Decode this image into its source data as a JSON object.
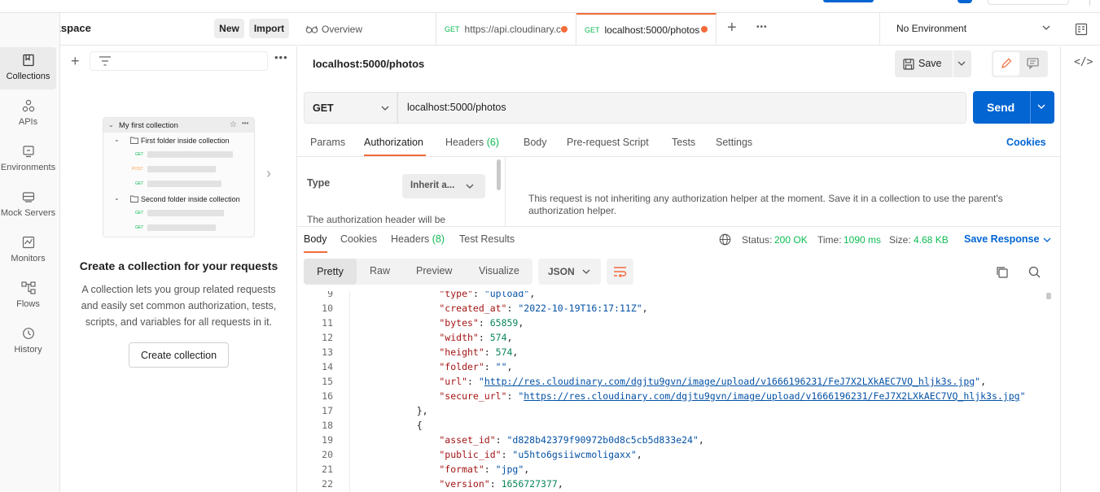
{
  "workspace": {
    "title": "My Workspace",
    "new_label": "New",
    "import_label": "Import"
  },
  "rail": [
    {
      "label": "Collections",
      "icon": "collections-icon"
    },
    {
      "label": "APIs",
      "icon": "apis-icon"
    },
    {
      "label": "Environments",
      "icon": "environments-icon"
    },
    {
      "label": "Mock Servers",
      "icon": "mock-servers-icon"
    },
    {
      "label": "Monitors",
      "icon": "monitors-icon"
    },
    {
      "label": "Flows",
      "icon": "flows-icon"
    },
    {
      "label": "History",
      "icon": "history-icon"
    }
  ],
  "illustration": {
    "collection": "My first collection",
    "folder1": "First folder inside collection",
    "folder2": "Second folder inside collection",
    "m1": "GET",
    "m2": "POST",
    "m3": "GET",
    "m4": "GET",
    "m5": "GET"
  },
  "empty": {
    "title": "Create a collection for your requests",
    "desc": "A collection lets you group related requests and easily set common authorization, tests, scripts, and variables for all requests in it.",
    "button": "Create collection"
  },
  "tabs": [
    {
      "label": "Overview"
    },
    {
      "method": "GET",
      "label": "https://api.cloudinary.c"
    },
    {
      "method": "GET",
      "label": "localhost:5000/photos"
    }
  ],
  "environment": "No Environment",
  "request": {
    "name": "localhost:5000/photos",
    "save_label": "Save",
    "method": "GET",
    "url": "localhost:5000/photos",
    "send_label": "Send"
  },
  "req_tabs": {
    "params": "Params",
    "authorization": "Authorization",
    "headers": "Headers",
    "headers_count": "(6)",
    "body": "Body",
    "prerequest": "Pre-request Script",
    "tests": "Tests",
    "settings": "Settings",
    "cookies": "Cookies"
  },
  "auth": {
    "type_label": "Type",
    "type_value": "Inherit a...",
    "note": "The authorization header will be",
    "message": "This request is not inheriting any authorization helper at the moment. Save it in a collection to use the parent's authorization helper."
  },
  "response": {
    "tabs": {
      "body": "Body",
      "cookies": "Cookies",
      "headers": "Headers",
      "headers_count": "(8)",
      "tests": "Test Results"
    },
    "status_label": "Status:",
    "status": "200 OK",
    "time_label": "Time:",
    "time": "1090 ms",
    "size_label": "Size:",
    "size": "4.68 KB",
    "save_response": "Save Response",
    "views": {
      "pretty": "Pretty",
      "raw": "Raw",
      "preview": "Preview",
      "visualize": "Visualize"
    },
    "format": "JSON"
  },
  "code": [
    {
      "n": "9",
      "parts": [
        [
          "k",
          "        \"type\""
        ],
        [
          "p",
          ": "
        ],
        [
          "s",
          "\"upload\""
        ],
        [
          "p",
          ","
        ]
      ]
    },
    {
      "n": "10",
      "parts": [
        [
          "k",
          "        \"created_at\""
        ],
        [
          "p",
          ": "
        ],
        [
          "s",
          "\"2022-10-19T16:17:11Z\""
        ],
        [
          "p",
          ","
        ]
      ]
    },
    {
      "n": "11",
      "parts": [
        [
          "k",
          "        \"bytes\""
        ],
        [
          "p",
          ": "
        ],
        [
          "n",
          "65859"
        ],
        [
          "p",
          ","
        ]
      ]
    },
    {
      "n": "12",
      "parts": [
        [
          "k",
          "        \"width\""
        ],
        [
          "p",
          ": "
        ],
        [
          "n",
          "574"
        ],
        [
          "p",
          ","
        ]
      ]
    },
    {
      "n": "13",
      "parts": [
        [
          "k",
          "        \"height\""
        ],
        [
          "p",
          ": "
        ],
        [
          "n",
          "574"
        ],
        [
          "p",
          ","
        ]
      ]
    },
    {
      "n": "14",
      "parts": [
        [
          "k",
          "        \"folder\""
        ],
        [
          "p",
          ": "
        ],
        [
          "s",
          "\"\""
        ],
        [
          "p",
          ","
        ]
      ]
    },
    {
      "n": "15",
      "parts": [
        [
          "k",
          "        \"url\""
        ],
        [
          "p",
          ": "
        ],
        [
          "s",
          "\""
        ],
        [
          "u",
          "http://res.cloudinary.com/dgjtu9gvn/image/upload/v1666196231/FeJ7X2LXkAEC7VQ_hljk3s.jpg"
        ],
        [
          "s",
          "\""
        ],
        [
          "p",
          ","
        ]
      ]
    },
    {
      "n": "16",
      "parts": [
        [
          "k",
          "        \"secure_url\""
        ],
        [
          "p",
          ": "
        ],
        [
          "s",
          "\""
        ],
        [
          "u",
          "https://res.cloudinary.com/dgjtu9gvn/image/upload/v1666196231/FeJ7X2LXkAEC7VQ_hljk3s.jpg"
        ],
        [
          "s",
          "\""
        ]
      ]
    },
    {
      "n": "17",
      "parts": [
        [
          "p",
          "    },"
        ]
      ]
    },
    {
      "n": "18",
      "parts": [
        [
          "p",
          "    {"
        ]
      ]
    },
    {
      "n": "19",
      "parts": [
        [
          "k",
          "        \"asset_id\""
        ],
        [
          "p",
          ": "
        ],
        [
          "s",
          "\"d828b42379f90972b0d8c5cb5d833e24\""
        ],
        [
          "p",
          ","
        ]
      ]
    },
    {
      "n": "20",
      "parts": [
        [
          "k",
          "        \"public_id\""
        ],
        [
          "p",
          ": "
        ],
        [
          "s",
          "\"u5hto6gsiiwcmoligaxx\""
        ],
        [
          "p",
          ","
        ]
      ]
    },
    {
      "n": "21",
      "parts": [
        [
          "k",
          "        \"format\""
        ],
        [
          "p",
          ": "
        ],
        [
          "s",
          "\"jpg\""
        ],
        [
          "p",
          ","
        ]
      ]
    },
    {
      "n": "22",
      "parts": [
        [
          "k",
          "        \"version\""
        ],
        [
          "p",
          ": "
        ],
        [
          "n",
          "1656727377"
        ],
        [
          "p",
          ","
        ]
      ]
    }
  ]
}
